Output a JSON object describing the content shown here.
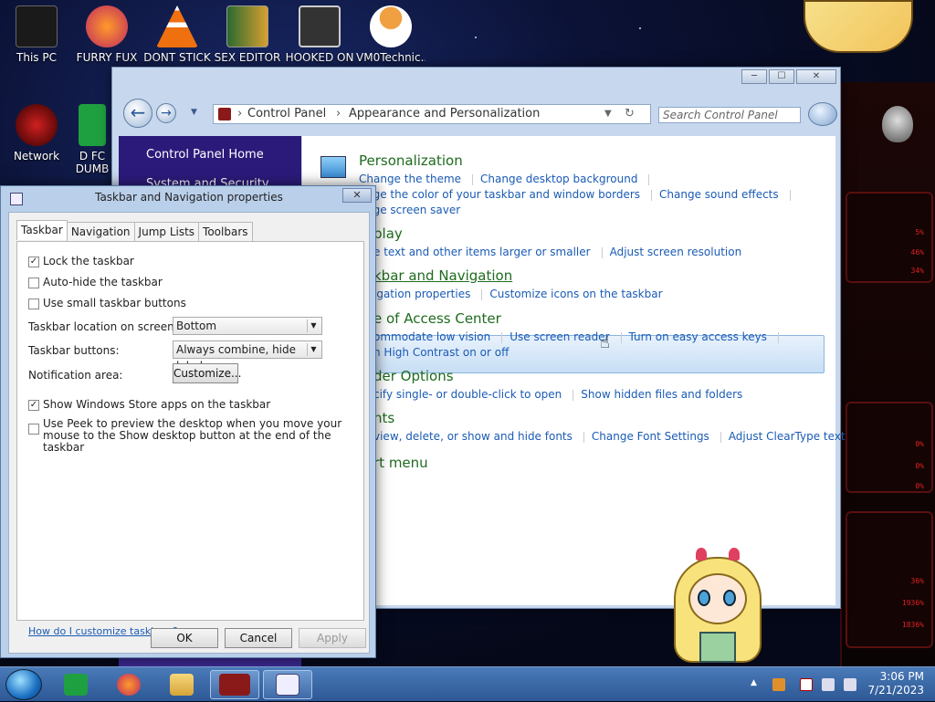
{
  "desktop": {
    "icons": [
      {
        "label": "This PC",
        "color": "#1a1a1a"
      },
      {
        "label": "FURRY FUX",
        "color": "#e05a20"
      },
      {
        "label": "DONT STICK",
        "color": "#f07010"
      },
      {
        "label": "SEX EDITOR",
        "color": "#d8a030"
      },
      {
        "label": "HOOKED ON",
        "color": "#333333"
      },
      {
        "label": "VM0Technic...",
        "color": "#f0a040"
      },
      {
        "label": "Network",
        "color": "#a01818"
      },
      {
        "label": "D FC DUMB",
        "color": "#1fa040"
      }
    ]
  },
  "control_panel": {
    "window_buttons": [
      "─",
      "☐",
      "✕"
    ],
    "address": {
      "crumb1": "Control Panel",
      "crumb2": "Appearance and Personalization",
      "sep": "›"
    },
    "search_placeholder": "Search Control Panel",
    "sidebar": [
      "Control Panel Home",
      "System and Security"
    ],
    "categories": [
      {
        "title": "Personalization",
        "links": [
          "Change the theme",
          "Change desktop background",
          "nge the color of your taskbar and window borders",
          "Change sound effects",
          "nge screen saver"
        ]
      },
      {
        "title": "play",
        "links": [
          "e text and other items larger or smaller",
          "Adjust screen resolution"
        ]
      },
      {
        "title": "kbar and Navigation",
        "links": [
          "igation properties",
          "Customize icons on the taskbar"
        ]
      },
      {
        "title": "e of Access Center",
        "links": [
          "ommodate low vision",
          "Use screen reader",
          "Turn on easy access keys",
          "n High Contrast on or off"
        ]
      },
      {
        "title": "der Options",
        "links": [
          "cify single- or double-click to open",
          "Show hidden files and folders"
        ]
      },
      {
        "title": "nts",
        "links": [
          "view, delete, or show and hide fonts",
          "Change Font Settings",
          "Adjust ClearType text"
        ]
      },
      {
        "title": "rt menu",
        "links": []
      }
    ]
  },
  "dialog": {
    "title": "Taskbar and Navigation properties",
    "close": "✕",
    "tabs": [
      "Taskbar",
      "Navigation",
      "Jump Lists",
      "Toolbars"
    ],
    "options": {
      "lock": {
        "label": "Lock the taskbar",
        "checked": "✓"
      },
      "autohide": {
        "label": "Auto-hide the taskbar",
        "checked": ""
      },
      "small": {
        "label": "Use small taskbar buttons",
        "checked": ""
      },
      "store": {
        "label": "Show Windows Store apps on the taskbar",
        "checked": "✓"
      },
      "peek": {
        "label": "Use Peek to preview the desktop when you move your mouse to the Show desktop button at the end of the taskbar",
        "checked": ""
      }
    },
    "location_label": "Taskbar location on screen:",
    "location_value": "Bottom",
    "buttons_label": "Taskbar buttons:",
    "buttons_value": "Always combine, hide labels",
    "notification_label": "Notification area:",
    "customize": "Customize...",
    "help_link": "How do I customize taskbars?",
    "ok": "OK",
    "cancel": "Cancel",
    "apply": "Apply"
  },
  "panel_values": [
    "5%",
    "46%",
    "34%",
    "0%",
    "0%",
    "0%",
    "36%",
    "1936%",
    "1836%"
  ],
  "taskbar": {
    "time": "3:06 PM",
    "date": "7/21/2023"
  }
}
